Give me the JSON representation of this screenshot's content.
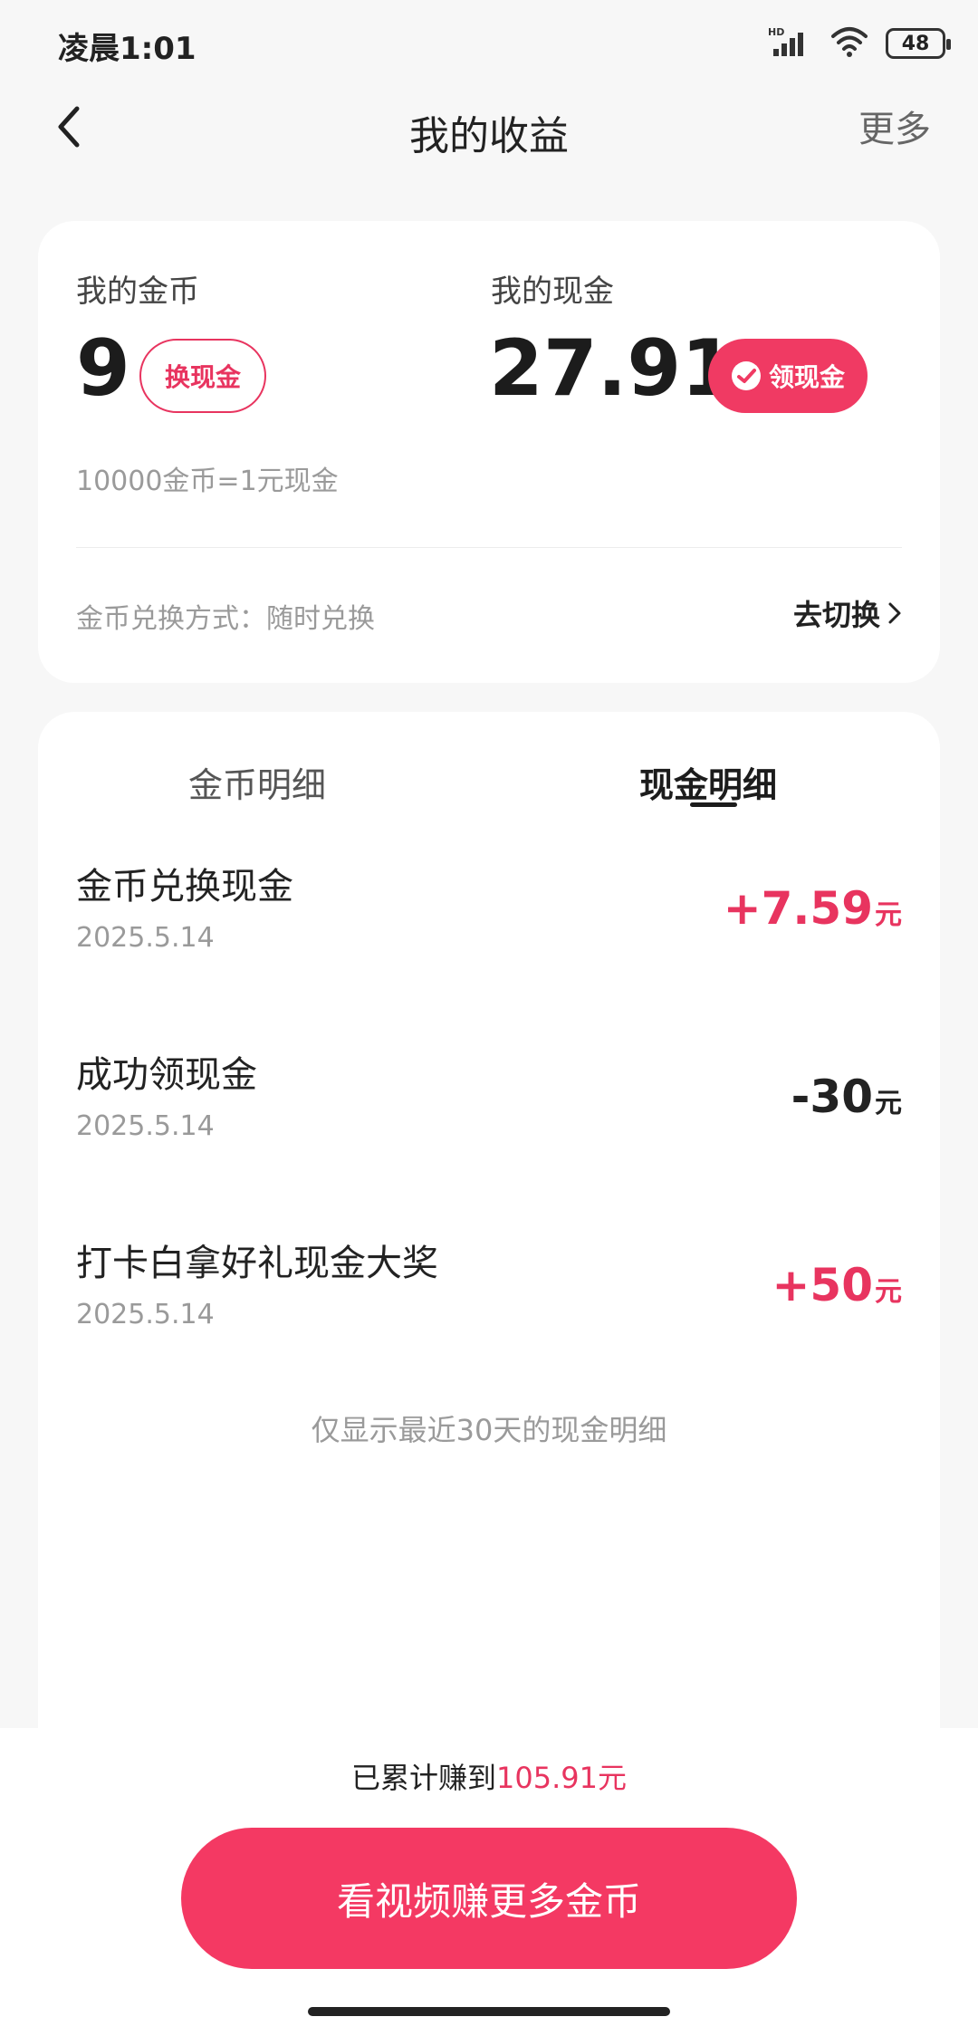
{
  "status_bar": {
    "time": "凌晨1:01",
    "hd_label": "HD",
    "battery": "48",
    "icons": [
      "signal-icon",
      "wifi-icon",
      "battery-icon"
    ]
  },
  "header": {
    "title": "我的收益",
    "more_label": "更多"
  },
  "summary": {
    "coin_label": "我的金币",
    "coin_value": "9",
    "exchange_button": "换现金",
    "cash_label": "我的现金",
    "cash_value": "27.91",
    "claim_button": "领现金",
    "rate_text": "10000金币=1元现金",
    "exchange_method": "金币兑换方式：随时兑换",
    "switch_label": "去切换"
  },
  "tabs": {
    "coin": "金币明细",
    "cash": "现金明细",
    "active": "cash"
  },
  "records": [
    {
      "title": "金币兑换现金",
      "date": "2025.5.14",
      "amount": "+7.59",
      "unit": "元"
    },
    {
      "title": "成功领现金",
      "date": "2025.5.14",
      "amount": "-30",
      "unit": "元"
    },
    {
      "title": "打卡白拿好礼现金大奖",
      "date": "2025.5.14",
      "amount": "+50",
      "unit": "元"
    }
  ],
  "recent_note": "仅显示最近30天的现金明细",
  "footer": {
    "total_prefix": "已累计赚到",
    "total_value": "105.91元",
    "cta_label": "看视频赚更多金币"
  },
  "colors": {
    "accent": "#f03a63",
    "text": "#222222",
    "muted": "#9a9a9a",
    "background": "#f7f7f7"
  }
}
